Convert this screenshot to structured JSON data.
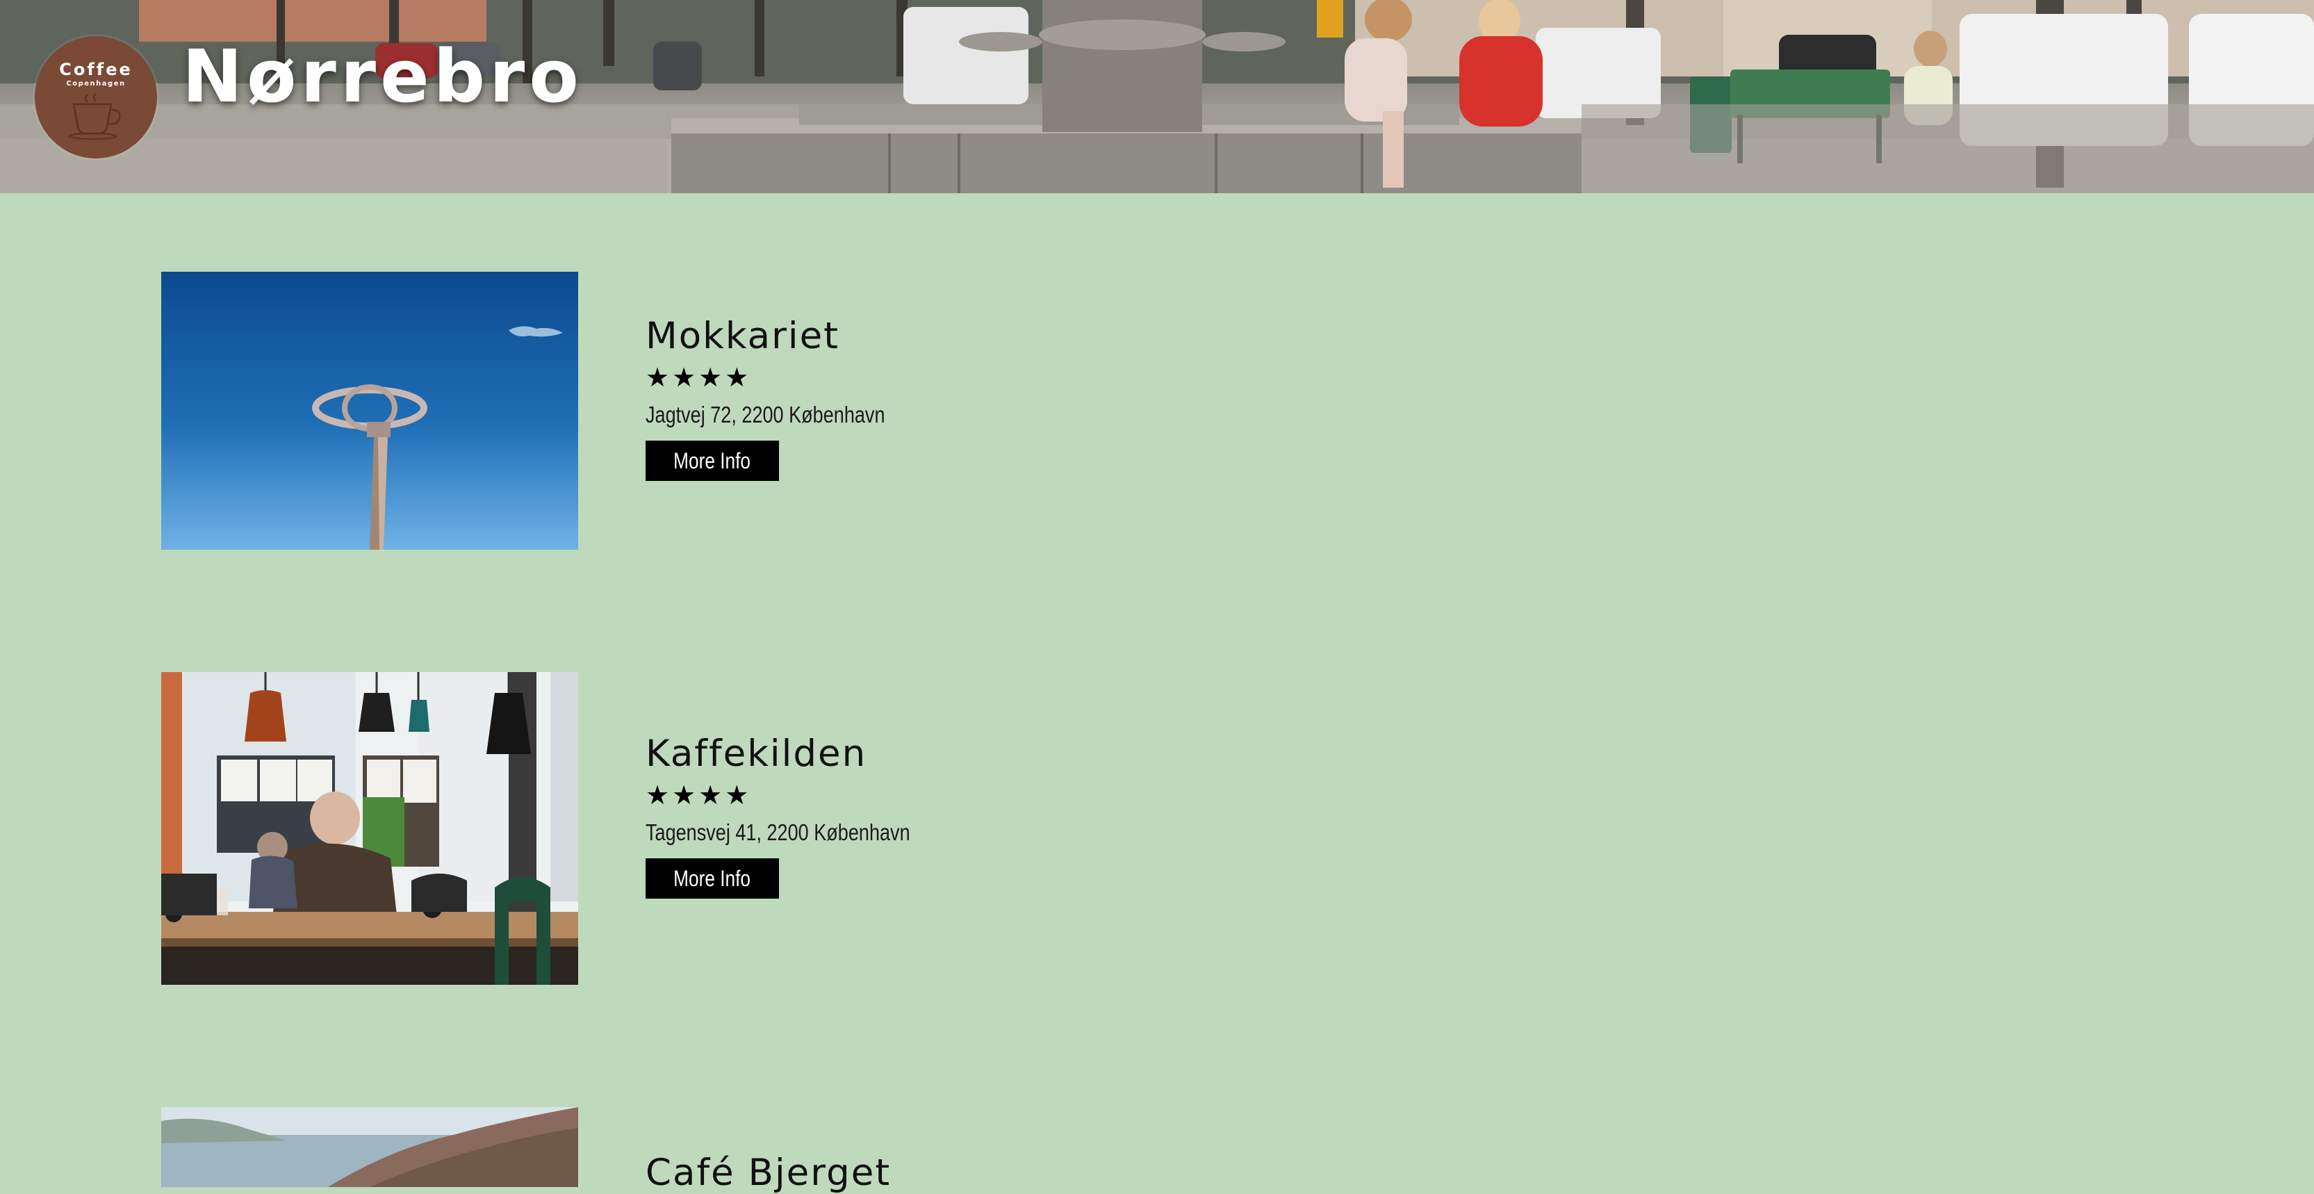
{
  "header": {
    "logo": {
      "line1": "Coffee",
      "line2": "Copenhagen"
    },
    "title": "Nørrebro"
  },
  "cafes": [
    {
      "name": "Mokkariet",
      "rating": 4,
      "stars": "★★★★",
      "address": "Jagtvej 72, 2200 København",
      "button_label": "More Info",
      "image": "sky-sculpture-photo"
    },
    {
      "name": "Kaffekilden",
      "rating": 4,
      "stars": "★★★★",
      "address": "Tagensvej 41, 2200 København",
      "button_label": "More Info",
      "image": "cafe-interior-photo"
    },
    {
      "name": "Café Bjerget",
      "image": "coastal-hill-photo"
    }
  ],
  "colors": {
    "page_background": "#bfd9bc",
    "logo_brown": "#7a4a36",
    "button_black": "#000000"
  }
}
